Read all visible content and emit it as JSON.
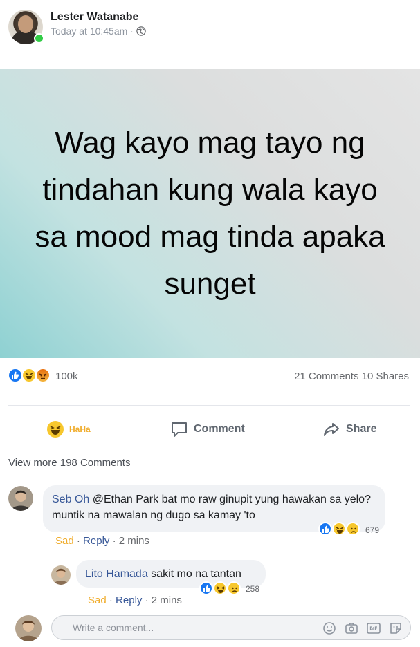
{
  "post": {
    "author": "Lester Watanabe",
    "timestamp": "Today at 10:45am ·",
    "privacy_icon": "globe-icon",
    "status_text": "Wag kayo mag tayo ng tindahan kung wala kayo sa mood mag tinda apaka sunget",
    "status_colors": {
      "gradient_from": "#8ed1d2",
      "gradient_to": "#e4e4e4"
    },
    "online_color": "#31cc46"
  },
  "summary": {
    "reaction_icons": [
      "like-icon",
      "haha-icon",
      "angry-icon"
    ],
    "reaction_count": "100k",
    "comments_shares": "21 Comments 10 Shares"
  },
  "actions": {
    "react_label": "HaHa",
    "comment_label": "Comment",
    "share_label": "Share"
  },
  "view_more": "View more 198 Comments",
  "comments": [
    {
      "name": "Seb Oh",
      "text": "@Ethan Park bat mo raw ginupit yung hawakan sa yelo? muntik na mawalan ng dugo sa kamay 'to",
      "reaction_label": "Sad",
      "reply_label": "Reply",
      "time": "2 mins",
      "reaction_icons": [
        "like-icon",
        "haha-icon",
        "sad-icon"
      ],
      "reaction_count": "679"
    },
    {
      "name": "Lito Hamada",
      "text": "sakit mo na tantan",
      "reaction_label": "Sad",
      "reply_label": "Reply",
      "time": "2 mins",
      "reaction_icons": [
        "like-icon",
        "haha-icon",
        "sad-icon"
      ],
      "reaction_count": "258"
    }
  ],
  "composer": {
    "placeholder": "Write a comment...",
    "icons": [
      "emoji-icon",
      "camera-icon",
      "gif-icon",
      "sticker-icon"
    ]
  },
  "colors": {
    "link": "#385898",
    "accent": "#1877f2",
    "haha": "#f0ad2d"
  }
}
